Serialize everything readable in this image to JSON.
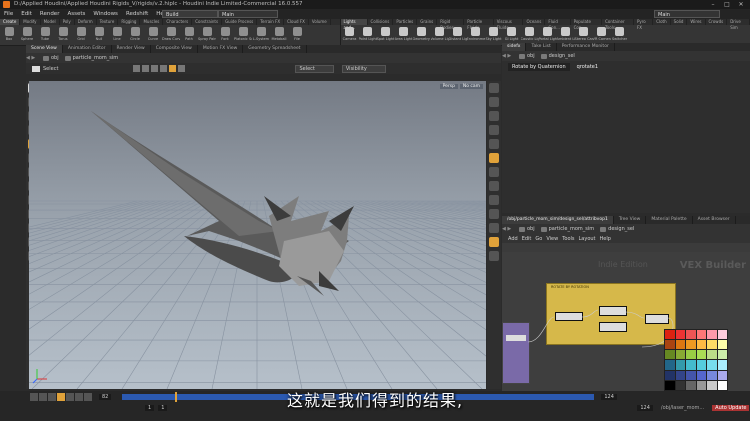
{
  "titlebar": {
    "title": "D:/Applied Houdini/Applied Houdini Rigids_V/rigids/v.2.hiplc - Houdini Indie Limited-Commercial 16.0.557"
  },
  "menu": {
    "items": [
      "File",
      "Edit",
      "Render",
      "Assets",
      "Windows",
      "Redshift",
      "Help"
    ],
    "build": "Build",
    "desktop": "Main",
    "workspace": "Main"
  },
  "shelf": {
    "tabs_left": [
      "Create",
      "Modify",
      "Model",
      "Poly",
      "Deform",
      "Texture",
      "Rigging",
      "Muscles",
      "Characters",
      "Constraints",
      "Guide Process",
      "Terrain FX",
      "Cloud FX",
      "Volume"
    ],
    "tabs_right": [
      "Lights and...",
      "Collisions",
      "Particles",
      "Grains",
      "Rigid Bodies",
      "Particle Fluids",
      "Viscous Fluids",
      "Oceans",
      "Fluid Con...",
      "Populate Con...",
      "Container Tools",
      "Pyro FX",
      "Cloth",
      "Solid",
      "Wires",
      "Crowds",
      "Drive Sim"
    ],
    "tools_left": [
      "Box",
      "Sphere",
      "Tube",
      "Torus",
      "Grid",
      "Null",
      "Line",
      "Circle",
      "Curve",
      "Draw Curve",
      "Path",
      "Spray Paint",
      "Font",
      "Platonic Solids",
      "L-System",
      "Metaball",
      "File"
    ],
    "tools_right": [
      "Camera",
      "Point Light",
      "Spot Light",
      "Area Light",
      "Geometry Light",
      "Volume Light",
      "Distant Light",
      "Environment Light",
      "Sky Light",
      "GI Light",
      "Caustic Light",
      "Portal Light",
      "Ambient Light",
      "Stereo Camera",
      "VR Camera",
      "Switcher"
    ]
  },
  "left_tabs": [
    "Scene View",
    "Animation Editor",
    "Render View",
    "Composite View",
    "Motion FX View",
    "Geometry Spreadsheet"
  ],
  "left_path": {
    "obj": "obj",
    "node": "particle_mom_sim"
  },
  "viewport": {
    "select_label": "Select",
    "dropdown1": "Select",
    "dropdown2": "Visibility",
    "persp": "Persp",
    "cam": "No cam"
  },
  "param": {
    "tabs": [
      "sidefx",
      "Take List",
      "Performance Monitor"
    ],
    "obj": "obj",
    "node": "design_sel",
    "field_label": "Rotate by Quaternion",
    "field_value": "qrotate1"
  },
  "net": {
    "tabs": [
      "/obj/particle_mom_sim/design_sel/attribvop1",
      "Tree View",
      "Material Palette",
      "Asset Browser"
    ],
    "obj": "obj",
    "node1": "particle_mom_sim",
    "node2": "design_sel",
    "menu": [
      "Add",
      "Edit",
      "Go",
      "View",
      "Tools",
      "Layout",
      "Help"
    ],
    "watermark_l": "Indie Edition",
    "watermark_r": "VEX Builder",
    "box_label": "ROTATE BY ROTATION"
  },
  "timeline": {
    "frame": "82",
    "start": "1",
    "end": "1",
    "range_end1": "124",
    "range_end2": "124",
    "status_path": "/obj/laser_mom...",
    "auto_update": "Auto Update"
  },
  "subtitle": "这就是我们得到的结果,",
  "colors": {
    "accent": "#e6b83c",
    "houdini_orange": "#e8731c",
    "timeline_blue": "#2b59b0",
    "box": "#d6b84a"
  }
}
